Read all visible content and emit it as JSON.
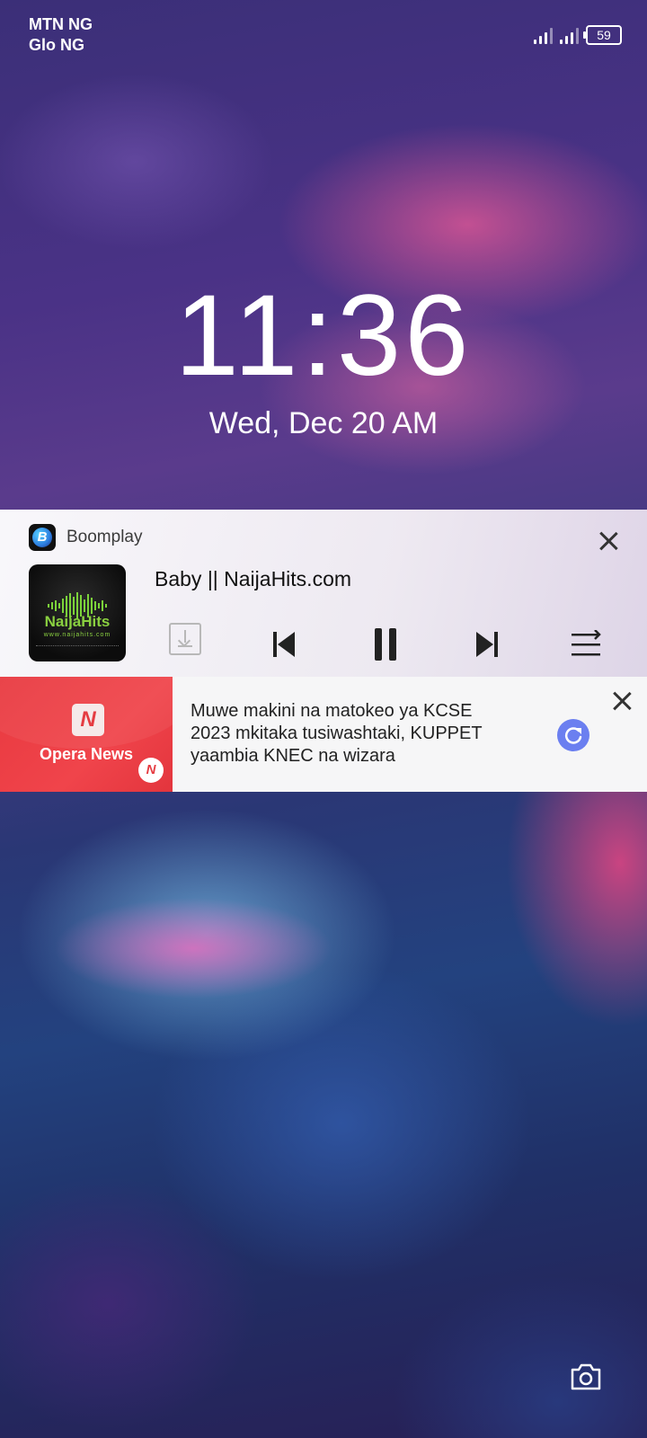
{
  "status_bar": {
    "carrier_1": "MTN NG",
    "carrier_2": "Glo NG",
    "battery": "59"
  },
  "lockscreen": {
    "time": "11:36",
    "date": "Wed, Dec 20  AM"
  },
  "media_notification": {
    "app_name": "Boomplay",
    "track_title": "Baby || NaijaHits.com",
    "album_art": {
      "brand": "NaijaHits",
      "site": "www.naijahits.com"
    },
    "controls": [
      "download-icon",
      "previous-icon",
      "pause-icon",
      "next-icon",
      "queue-icon"
    ]
  },
  "news_notification": {
    "app_name": "Opera News",
    "headline": "Muwe makini na matokeo ya KCSE 2023 mkitaka tusiwashtaki, KUPPET yaambia KNEC na wizara"
  },
  "colors": {
    "opera_red": "#e8393f",
    "refresh_blue": "#6b7ff0",
    "naijahits_green": "#8ad040"
  }
}
